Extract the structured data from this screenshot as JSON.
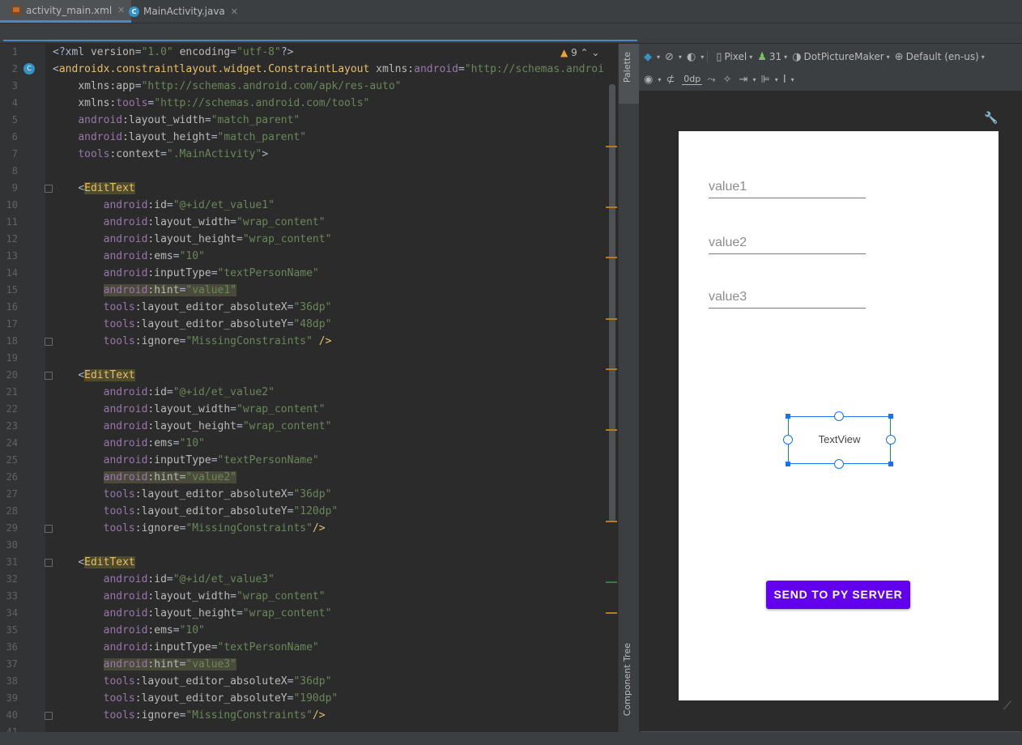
{
  "tabs": [
    {
      "label": "activity_main.xml",
      "icon": "xml-file-icon",
      "active": true
    },
    {
      "label": "MainActivity.java",
      "icon": "java-class-icon",
      "active": false
    }
  ],
  "editor": {
    "warnings_count": "9",
    "lines": [
      {
        "n": "1",
        "html": "<span class='t-pun'>&lt;?xml </span><span class='t-attr'>version</span><span class='t-pun'>=</span><span class='t-val'>\"1.0\"</span><span class='t-pun'> </span><span class='t-attr'>encoding</span><span class='t-pun'>=</span><span class='t-val'>\"utf-8\"</span><span class='t-pun'>?&gt;</span>"
      },
      {
        "n": "2",
        "html": "<span class='t-pun'>&lt;</span><span class='t-tag'>androidx.constraintlayout.widget.ConstraintLayout</span><span class='t-pun'> </span><span class='t-attr'>xmlns:</span><span class='t-ns'>android</span><span class='t-pun'>=</span><span class='t-val'>\"http://schemas.androi</span>"
      },
      {
        "n": "3",
        "html": "    <span class='t-attr'>xmlns:app</span><span class='t-pun'>=</span><span class='t-val'>\"http://schemas.android.com/apk/res-auto\"</span>"
      },
      {
        "n": "4",
        "html": "    <span class='t-attr'>xmlns:</span><span class='t-ns'>tools</span><span class='t-pun'>=</span><span class='t-val'>\"http://schemas.android.com/tools\"</span>"
      },
      {
        "n": "5",
        "html": "    <span class='t-ns'>android</span><span class='t-attr'>:layout_width</span><span class='t-pun'>=</span><span class='t-val'>\"match_parent\"</span>"
      },
      {
        "n": "6",
        "html": "    <span class='t-ns'>android</span><span class='t-attr'>:layout_height</span><span class='t-pun'>=</span><span class='t-val'>\"match_parent\"</span>"
      },
      {
        "n": "7",
        "html": "    <span class='t-ns'>tools</span><span class='t-attr'>:context</span><span class='t-pun'>=</span><span class='t-val'>\".MainActivity\"</span><span class='t-pun'>&gt;</span>"
      },
      {
        "n": "8",
        "html": ""
      },
      {
        "n": "9",
        "html": "    <span class='t-pun'>&lt;</span><span class='t-tagh'>EditText</span>"
      },
      {
        "n": "10",
        "html": "        <span class='t-ns'>android</span><span class='t-attr'>:id</span><span class='t-pun'>=</span><span class='t-val'>\"@+id/et_value1\"</span>"
      },
      {
        "n": "11",
        "html": "        <span class='t-ns'>android</span><span class='t-attr'>:layout_width</span><span class='t-pun'>=</span><span class='t-val'>\"wrap_content\"</span>"
      },
      {
        "n": "12",
        "html": "        <span class='t-ns'>android</span><span class='t-attr'>:layout_height</span><span class='t-pun'>=</span><span class='t-val'>\"wrap_content\"</span>"
      },
      {
        "n": "13",
        "html": "        <span class='t-ns'>android</span><span class='t-attr'>:ems</span><span class='t-pun'>=</span><span class='t-val'>\"10\"</span>"
      },
      {
        "n": "14",
        "html": "        <span class='t-ns'>android</span><span class='t-attr'>:inputType</span><span class='t-pun'>=</span><span class='t-val'>\"textPersonName\"</span>"
      },
      {
        "n": "15",
        "html": "        <span class='t-hl'><span class='t-ns'>android</span><span class='t-attr'>:hint</span><span class='t-pun'>=</span><span class='t-val'>\"value1\"</span></span>"
      },
      {
        "n": "16",
        "html": "        <span class='t-ns'>tools</span><span class='t-attr'>:layout_editor_absoluteX</span><span class='t-pun'>=</span><span class='t-val'>\"36dp\"</span>"
      },
      {
        "n": "17",
        "html": "        <span class='t-ns'>tools</span><span class='t-attr'>:layout_editor_absoluteY</span><span class='t-pun'>=</span><span class='t-val'>\"48dp\"</span>"
      },
      {
        "n": "18",
        "html": "        <span class='t-ns'>tools</span><span class='t-attr'>:ignore</span><span class='t-pun'>=</span><span class='t-val'>\"MissingConstraints\"</span><span class='t-pun'> </span><span class='t-tag'>/&gt;</span>"
      },
      {
        "n": "19",
        "html": ""
      },
      {
        "n": "20",
        "html": "    <span class='t-pun'>&lt;</span><span class='t-tagh'>EditText</span>"
      },
      {
        "n": "21",
        "html": "        <span class='t-ns'>android</span><span class='t-attr'>:id</span><span class='t-pun'>=</span><span class='t-val'>\"@+id/et_value2\"</span>"
      },
      {
        "n": "22",
        "html": "        <span class='t-ns'>android</span><span class='t-attr'>:layout_width</span><span class='t-pun'>=</span><span class='t-val'>\"wrap_content\"</span>"
      },
      {
        "n": "23",
        "html": "        <span class='t-ns'>android</span><span class='t-attr'>:layout_height</span><span class='t-pun'>=</span><span class='t-val'>\"wrap_content\"</span>"
      },
      {
        "n": "24",
        "html": "        <span class='t-ns'>android</span><span class='t-attr'>:ems</span><span class='t-pun'>=</span><span class='t-val'>\"10\"</span>"
      },
      {
        "n": "25",
        "html": "        <span class='t-ns'>android</span><span class='t-attr'>:inputType</span><span class='t-pun'>=</span><span class='t-val'>\"textPersonName\"</span>"
      },
      {
        "n": "26",
        "html": "        <span class='t-hl'><span class='t-ns'>android</span><span class='t-attr'>:hint</span><span class='t-pun'>=</span><span class='t-val'>\"value2\"</span></span>"
      },
      {
        "n": "27",
        "html": "        <span class='t-ns'>tools</span><span class='t-attr'>:layout_editor_absoluteX</span><span class='t-pun'>=</span><span class='t-val'>\"36dp\"</span>"
      },
      {
        "n": "28",
        "html": "        <span class='t-ns'>tools</span><span class='t-attr'>:layout_editor_absoluteY</span><span class='t-pun'>=</span><span class='t-val'>\"120dp\"</span>"
      },
      {
        "n": "29",
        "html": "        <span class='t-ns'>tools</span><span class='t-attr'>:ignore</span><span class='t-pun'>=</span><span class='t-val'>\"MissingConstraints\"</span><span class='t-tag'>/&gt;</span>"
      },
      {
        "n": "30",
        "html": ""
      },
      {
        "n": "31",
        "html": "    <span class='t-pun'>&lt;</span><span class='t-tagh'>EditText</span>"
      },
      {
        "n": "32",
        "html": "        <span class='t-ns'>android</span><span class='t-attr'>:id</span><span class='t-pun'>=</span><span class='t-val'>\"@+id/et_value3\"</span>"
      },
      {
        "n": "33",
        "html": "        <span class='t-ns'>android</span><span class='t-attr'>:layout_width</span><span class='t-pun'>=</span><span class='t-val'>\"wrap_content\"</span>"
      },
      {
        "n": "34",
        "html": "        <span class='t-ns'>android</span><span class='t-attr'>:layout_height</span><span class='t-pun'>=</span><span class='t-val'>\"wrap_content\"</span>"
      },
      {
        "n": "35",
        "html": "        <span class='t-ns'>android</span><span class='t-attr'>:ems</span><span class='t-pun'>=</span><span class='t-val'>\"10\"</span>"
      },
      {
        "n": "36",
        "html": "        <span class='t-ns'>android</span><span class='t-attr'>:inputType</span><span class='t-pun'>=</span><span class='t-val'>\"textPersonName\"</span>"
      },
      {
        "n": "37",
        "html": "        <span class='t-hl'><span class='t-ns'>android</span><span class='t-attr'>:hint</span><span class='t-pun'>=</span><span class='t-val'>\"value3\"</span></span>"
      },
      {
        "n": "38",
        "html": "        <span class='t-ns'>tools</span><span class='t-attr'>:layout_editor_absoluteX</span><span class='t-pun'>=</span><span class='t-val'>\"36dp\"</span>"
      },
      {
        "n": "39",
        "html": "        <span class='t-ns'>tools</span><span class='t-attr'>:layout_editor_absoluteY</span><span class='t-pun'>=</span><span class='t-val'>\"190dp\"</span>"
      },
      {
        "n": "40",
        "html": "        <span class='t-ns'>tools</span><span class='t-attr'>:ignore</span><span class='t-pun'>=</span><span class='t-val'>\"MissingConstraints\"</span><span class='t-tag'>/&gt;</span>"
      },
      {
        "n": "41",
        "html": ""
      }
    ]
  },
  "side_strip": {
    "palette": "Palette",
    "component_tree": "Component Tree"
  },
  "design_toolbar": {
    "device": "Pixel",
    "api": "31",
    "theme": "DotPictureMaker",
    "locale": "Default (en-us)",
    "margin": "0dp"
  },
  "preview": {
    "edit_texts": [
      {
        "hint": "value1"
      },
      {
        "hint": "value2"
      },
      {
        "hint": "value3"
      }
    ],
    "text_view": "TextView",
    "button": "SEND TO PY SERVER"
  },
  "colors": {
    "button": "#6200ee",
    "selection": "#1a73e8",
    "editor_bg": "#2b2b2b"
  }
}
